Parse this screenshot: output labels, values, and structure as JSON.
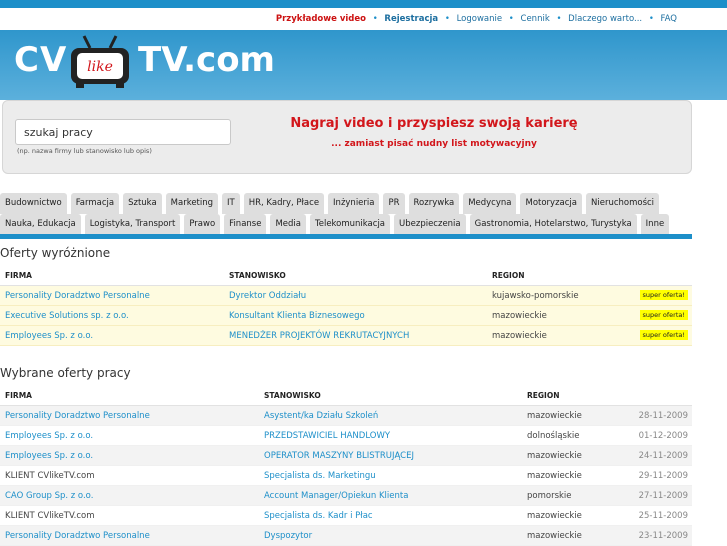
{
  "nav": {
    "items": [
      "Przykładowe video",
      "Rejestracja",
      "Logowanie",
      "Cennik",
      "Dlaczego warto...",
      "FAQ"
    ],
    "separator": "•"
  },
  "logo": {
    "left": "CV",
    "tv_text": "like",
    "right": "TV.com"
  },
  "search": {
    "value": "szukaj pracy",
    "hint": "(np. nazwa firmy lub stanowisko lub opis)"
  },
  "promo": {
    "headline": "Nagraj video i przyspiesz swoją karierę",
    "subline": "... zamiast pisać nudny list motywacyjny"
  },
  "categories": {
    "row1": [
      "Budownictwo",
      "Farmacja",
      "Sztuka",
      "Marketing",
      "IT",
      "HR, Kadry, Płace",
      "Inżynieria",
      "PR",
      "Rozrywka",
      "Medycyna",
      "Motoryzacja",
      "Nieruchomości"
    ],
    "row2": [
      "Nauka, Edukacja",
      "Logistyka, Transport",
      "Prawo",
      "Finanse",
      "Media",
      "Telekomunikacja",
      "Ubezpieczenia",
      "Gastronomia, Hotelarstwo, Turystyka",
      "Inne"
    ]
  },
  "featured": {
    "title": "Oferty wyróżnione",
    "headers": [
      "FIRMA",
      "STANOWISKO",
      "REGION"
    ],
    "badge": "super oferta!",
    "rows": [
      [
        "Personality Doradztwo Personalne",
        "Dyrektor Oddziału",
        "kujawsko-pomorskie"
      ],
      [
        "Executive Solutions sp. z o.o.",
        "Konsultant Klienta Biznesowego",
        "mazowieckie"
      ],
      [
        "Employees Sp. z o.o.",
        "MENEDŻER PROJEKTÓW REKRUTACYJNYCH",
        "mazowieckie"
      ]
    ]
  },
  "selected": {
    "title": "Wybrane oferty pracy",
    "headers": [
      "FIRMA",
      "STANOWISKO",
      "REGION"
    ],
    "rows": [
      [
        "Personality Doradztwo Personalne",
        "Asystent/ka Działu Szkoleń",
        "mazowieckie",
        "28-11-2009"
      ],
      [
        "Employees Sp. z o.o.",
        "PRZEDSTAWICIEL HANDLOWY",
        "dolnośląskie",
        "01-12-2009"
      ],
      [
        "Employees Sp. z o.o.",
        "OPERATOR MASZYNY BLISTRUJĄCEJ",
        "mazowieckie",
        "24-11-2009"
      ],
      [
        "KLIENT CVlikeTV.com",
        "Specjalista ds. Marketingu",
        "mazowieckie",
        "29-11-2009"
      ],
      [
        "CAO Group Sp. z o.o.",
        "Account Manager/Opiekun Klienta",
        "pomorskie",
        "27-11-2009"
      ],
      [
        "KLIENT CVlikeTV.com",
        "Specjalista ds. Kadr i Płac",
        "mazowieckie",
        "25-11-2009"
      ],
      [
        "Personality Doradztwo Personalne",
        "Dyspozytor",
        "mazowieckie",
        "23-11-2009"
      ]
    ]
  }
}
